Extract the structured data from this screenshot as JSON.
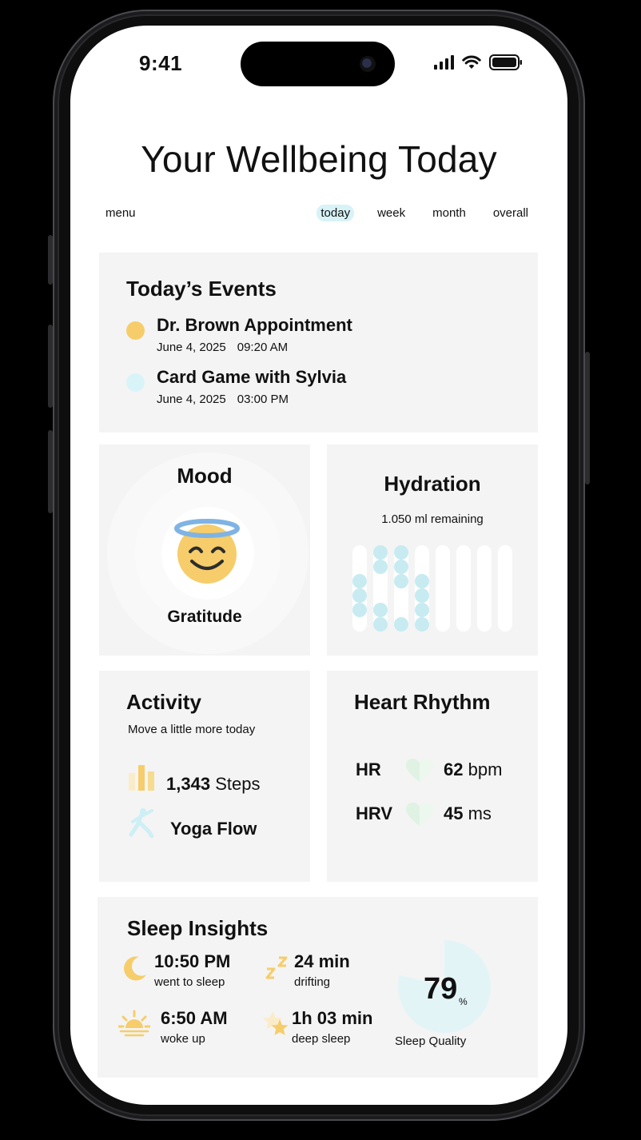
{
  "status": {
    "time": "9:41"
  },
  "page": {
    "title": "Your Wellbeing Today"
  },
  "nav": {
    "menu_label": "menu",
    "tabs": [
      {
        "label": "today",
        "active": true
      },
      {
        "label": "week",
        "active": false
      },
      {
        "label": "month",
        "active": false
      },
      {
        "label": "overall",
        "active": false
      }
    ]
  },
  "events": {
    "title": "Today’s Events",
    "items": [
      {
        "name": "Dr. Brown Appointment",
        "date": "June 4, 2025",
        "time": "09:20 AM",
        "color": "#f6cd6a"
      },
      {
        "name": "Card Game with Sylvia",
        "date": "June 4, 2025",
        "time": "03:00 PM",
        "color": "#d9f4f8"
      }
    ]
  },
  "mood": {
    "title": "Mood",
    "label": "Gratitude",
    "icon": "smiling-face-with-halo-icon"
  },
  "hydration": {
    "title": "Hydration",
    "remaining": "1.050 ml remaining",
    "color": "#c7ebf1"
  },
  "activity": {
    "title": "Activity",
    "subtitle": "Move a little more today",
    "steps_value": "1,343",
    "steps_unit": "Steps",
    "workout": "Yoga Flow"
  },
  "heart": {
    "title": "Heart Rhythm",
    "hr_label": "HR",
    "hr_value": "62",
    "hr_unit": "bpm",
    "hrv_label": "HRV",
    "hrv_value": "45",
    "hrv_unit": "ms"
  },
  "sleep": {
    "title": "Sleep Insights",
    "bedtime": "10:50 PM",
    "bedtime_label": "went to sleep",
    "drift": "24 min",
    "drift_label": "drifting",
    "wake": "6:50 AM",
    "wake_label": "woke up",
    "deep": "1h 03 min",
    "deep_label": "deep sleep",
    "quality_value": "79",
    "quality_unit": "%",
    "quality_label": "Sleep Quality",
    "quality_fraction": 0.79
  }
}
